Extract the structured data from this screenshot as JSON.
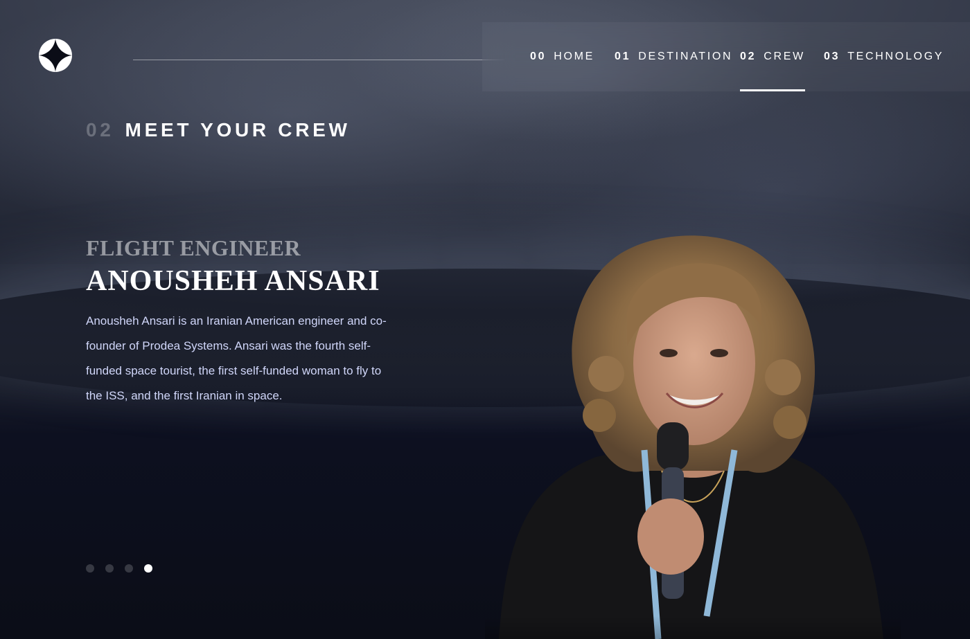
{
  "nav": {
    "items": [
      {
        "num": "00",
        "label": "HOME",
        "active": false
      },
      {
        "num": "01",
        "label": "DESTINATION",
        "active": false
      },
      {
        "num": "02",
        "label": "CREW",
        "active": true
      },
      {
        "num": "03",
        "label": "TECHNOLOGY",
        "active": false
      }
    ]
  },
  "page": {
    "section_num": "02",
    "section_title": "MEET YOUR CREW"
  },
  "crew": {
    "role": "FLIGHT ENGINEER",
    "name": "ANOUSHEH ANSARI",
    "bio": "Anousheh Ansari is an Iranian American engineer and co-founder of Prodea Systems. Ansari was the fourth self-funded space tourist, the first self-funded woman to fly to the ISS, and the first Iranian in space."
  },
  "slider": {
    "count": 4,
    "active_index": 3
  },
  "colors": {
    "background": "#0b0d17",
    "text_light": "#d0d6f9",
    "accent": "#ffffff"
  },
  "icons": {
    "logo": "four-point-star-logo-icon"
  }
}
